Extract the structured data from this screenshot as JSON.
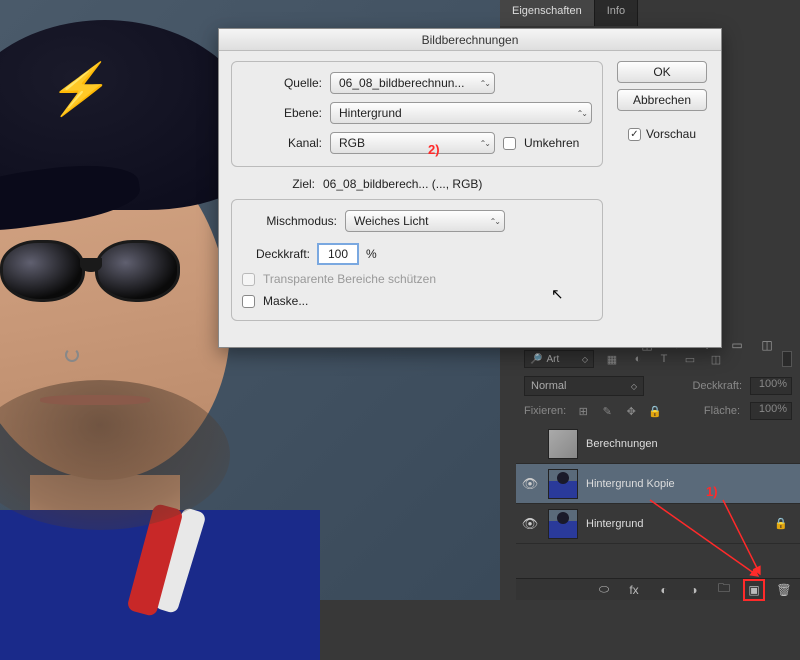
{
  "right_tabs": {
    "eigenschaften": "Eigenschaften",
    "info": "Info"
  },
  "layers_panel": {
    "filter_label": "Art",
    "blend_mode": "Normal",
    "opacity_label": "Deckkraft:",
    "opacity_value": "100%",
    "lock_label": "Fixieren:",
    "fill_label": "Fläche:",
    "fill_value": "100%",
    "layers": [
      {
        "name": "Berechnungen",
        "visible": false,
        "selected": false,
        "locked": false
      },
      {
        "name": "Hintergrund Kopie",
        "visible": true,
        "selected": true,
        "locked": false
      },
      {
        "name": "Hintergrund",
        "visible": true,
        "selected": false,
        "locked": true
      }
    ]
  },
  "dialog": {
    "title": "Bildberechnungen",
    "source_label": "Quelle:",
    "source_value": "06_08_bildberechnun...",
    "layer_label": "Ebene:",
    "layer_value": "Hintergrund",
    "channel_label": "Kanal:",
    "channel_value": "RGB",
    "invert_label": "Umkehren",
    "target_label": "Ziel:",
    "target_value": "06_08_bildberech... (..., RGB)",
    "blend_label": "Mischmodus:",
    "blend_value": "Weiches Licht",
    "opacity_label": "Deckkraft:",
    "opacity_value": "100",
    "opacity_unit": "%",
    "transparent_label": "Transparente Bereiche schützen",
    "mask_label": "Maske...",
    "ok": "OK",
    "cancel": "Abbrechen",
    "preview": "Vorschau"
  },
  "annotations": {
    "one": "1)",
    "two": "2)"
  },
  "icons": {
    "link": "⬭",
    "fx": "fx",
    "mask": "◐",
    "adj": "◑",
    "folder": "🗀",
    "new": "▣",
    "trash": "🗑",
    "eye": "👁",
    "lock": "🔒",
    "type": "T",
    "filter_img": "▦",
    "filter_adj": "◐",
    "filter_txt": "T",
    "filter_shape": "▭",
    "filter_smart": "◫",
    "lock_px": "⊞",
    "lock_brush": "✎",
    "lock_move": "✥",
    "lock_all": "🔒",
    "search": "🔍"
  }
}
